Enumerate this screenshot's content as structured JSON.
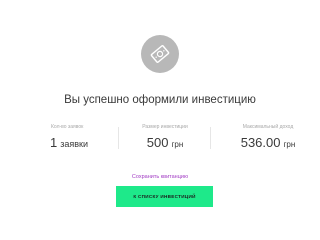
{
  "success": {
    "icon": "money-banknote-icon",
    "title": "Вы успешно оформили инвестицию"
  },
  "stats": [
    {
      "label": "Кол-во заявок",
      "value": "1",
      "unit": "заявки"
    },
    {
      "label": "Размер инвестиции",
      "value": "500",
      "unit": "грн"
    },
    {
      "label": "Максимальный доход",
      "value": "536.00",
      "unit": "грн"
    }
  ],
  "actions": {
    "save_receipt": "Сохранить квитанцию",
    "back_to_list": "К СПИСКУ ИНВЕСТИЦИЙ"
  },
  "colors": {
    "badge_bg": "#b8b8b8",
    "link": "#a23cc4",
    "button_bg": "#1ee98a"
  }
}
